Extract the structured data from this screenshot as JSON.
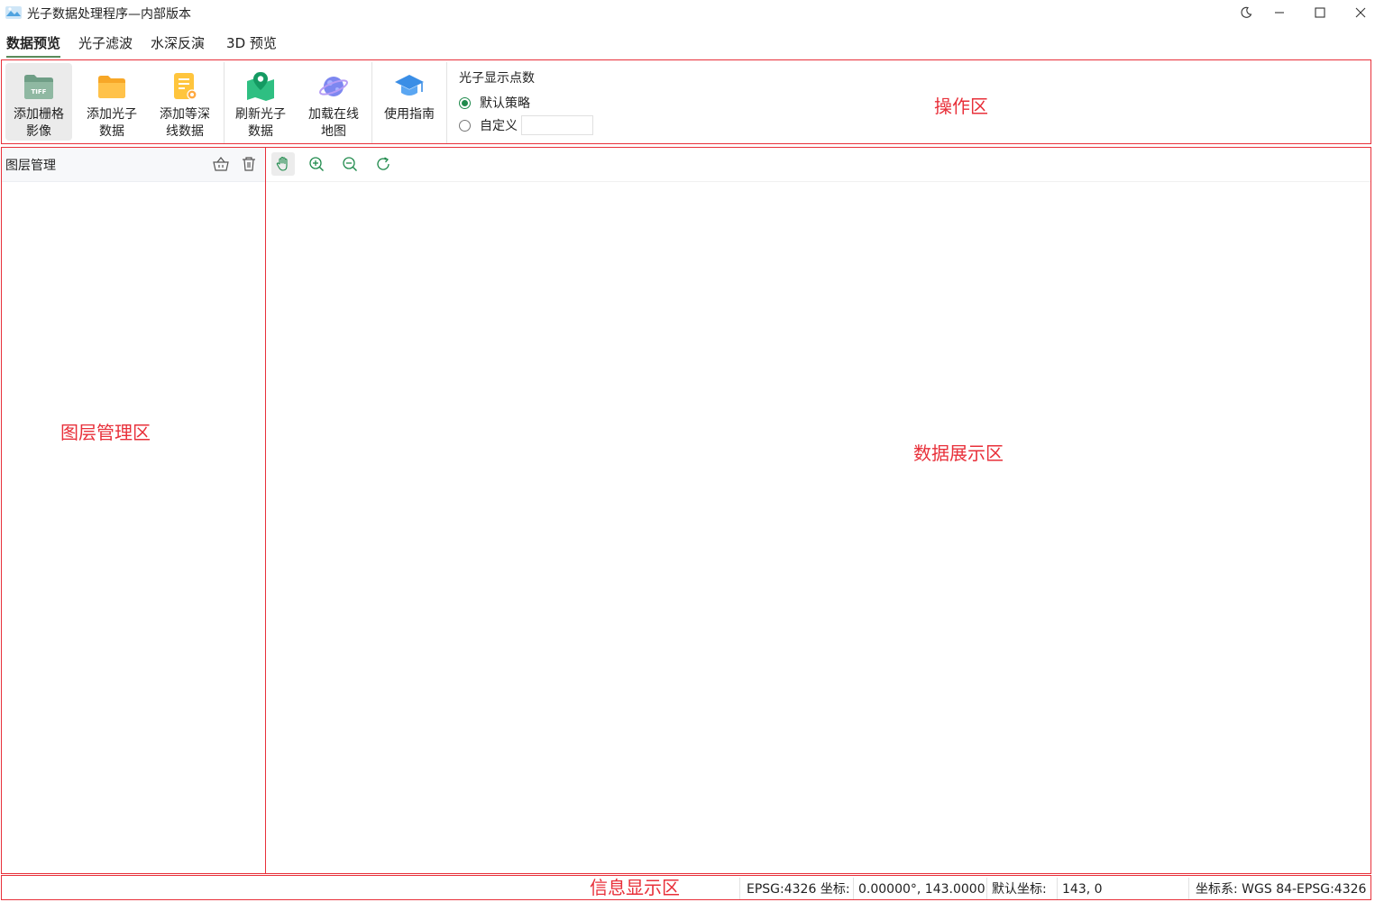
{
  "window": {
    "title": "光子数据处理程序—内部版本",
    "controls": [
      "theme-icon",
      "minimize-icon",
      "maximize-icon",
      "close-icon"
    ]
  },
  "tabs": [
    {
      "label": "数据预览",
      "active": true
    },
    {
      "label": "光子滤波",
      "active": false
    },
    {
      "label": "水深反演",
      "active": false
    },
    {
      "label": "3D 预览",
      "active": false
    }
  ],
  "ribbon": {
    "buttons": [
      {
        "line1": "添加栅格",
        "line2": "影像",
        "icon": "tiff-folder-icon",
        "active": true
      },
      {
        "line1": "添加光子",
        "line2": "数据",
        "icon": "folder-icon",
        "active": false
      },
      {
        "line1": "添加等深",
        "line2": "线数据",
        "icon": "document-icon",
        "active": false
      },
      {
        "line1": "刷新光子",
        "line2": "数据",
        "icon": "map-pin-icon",
        "active": false
      },
      {
        "line1": "加载在线",
        "line2": "地图",
        "icon": "planet-icon",
        "active": false
      },
      {
        "line1": "使用指南",
        "line2": "",
        "icon": "graduation-cap-icon",
        "active": false
      }
    ],
    "photon_points": {
      "title": "光子显示点数",
      "option_default": "默认策略",
      "option_custom": "自定义",
      "selected": "默认策略",
      "custom_value": ""
    },
    "zone_label": "操作区"
  },
  "layer_panel": {
    "title": "图层管理",
    "zone_label": "图层管理区"
  },
  "display": {
    "tools": [
      "pan-hand-icon",
      "zoom-in-icon",
      "zoom-out-icon",
      "reset-view-icon"
    ],
    "zone_label": "数据展示区"
  },
  "status": {
    "zone_label": "信息显示区",
    "coord_label": "EPSG:4326 坐标:",
    "coord_value": "0.00000°, 143.0000",
    "default_label": "默认坐标:",
    "default_value": "143, 0",
    "crs": "坐标系: WGS 84-EPSG:4326"
  },
  "colors": {
    "accent_green": "#1f8a4c",
    "annotation_red": "#e8303a"
  }
}
